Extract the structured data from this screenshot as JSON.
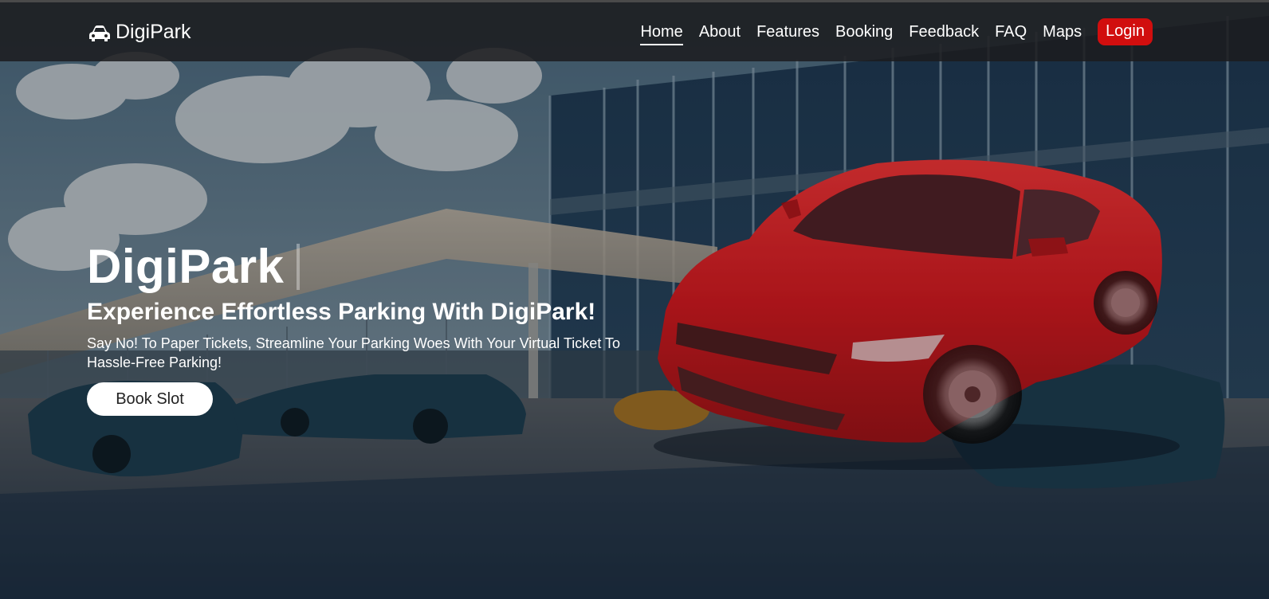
{
  "brand": {
    "name": "DigiPark",
    "icon": "car-icon"
  },
  "nav": {
    "items": [
      {
        "label": "Home",
        "active": true
      },
      {
        "label": "About"
      },
      {
        "label": "Features"
      },
      {
        "label": "Booking"
      },
      {
        "label": "Feedback"
      },
      {
        "label": "FAQ"
      },
      {
        "label": "Maps"
      }
    ],
    "login_label": "Login"
  },
  "hero": {
    "title": "DigiPark",
    "subtitle": "Experience Effortless Parking With DigiPark!",
    "description": "Say No! To Paper Tickets, Streamline Your Parking Woes With Your Virtual Ticket To Hassle-Free Parking!",
    "cta_label": "Book Slot"
  },
  "colors": {
    "login_button": "#d10e0e",
    "nav_background": "#1c1c1e",
    "car_red": "#d4141a",
    "text": "#ffffff"
  }
}
